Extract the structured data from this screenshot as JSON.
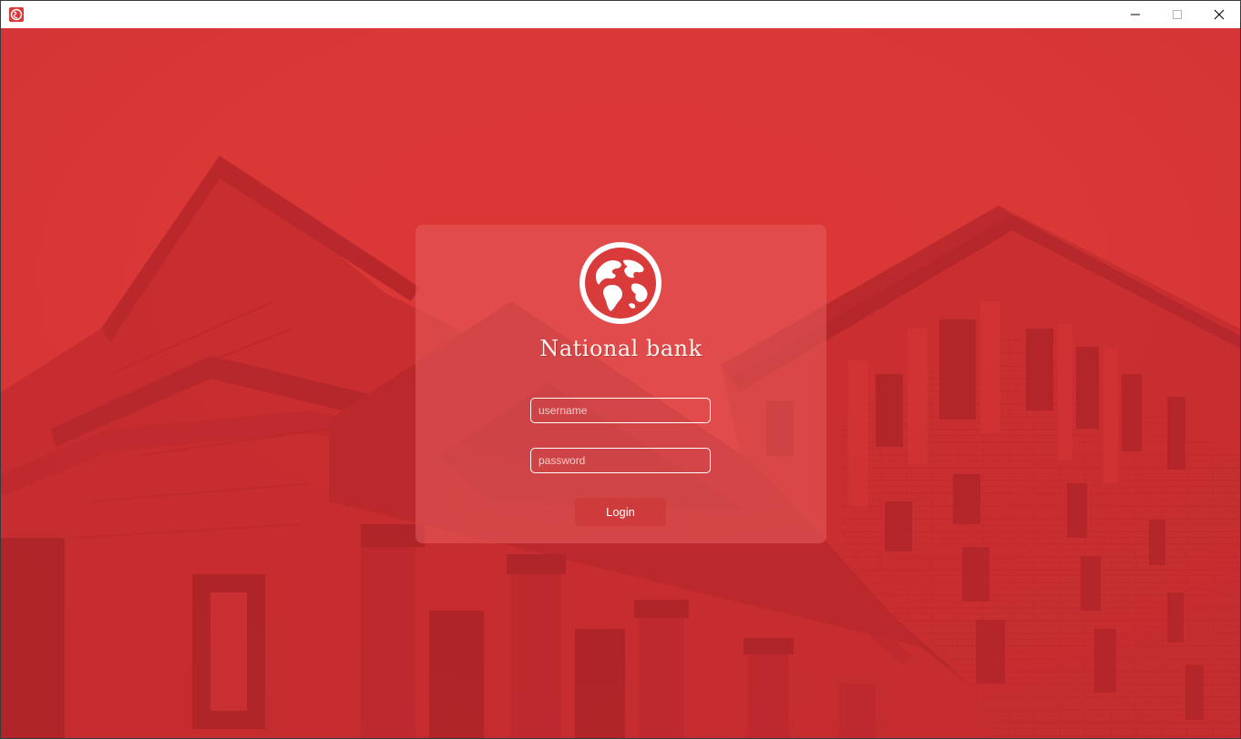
{
  "window": {
    "title": "",
    "controls": [
      "minimize",
      "maximize",
      "close"
    ]
  },
  "login": {
    "brand": "National bank",
    "username_placeholder": "username",
    "password_placeholder": "password",
    "login_label": "Login"
  },
  "icons": {
    "app": "globe-icon",
    "logo": "globe-icon",
    "minimize": "minimize-icon",
    "maximize": "maximize-icon",
    "close": "close-icon"
  },
  "colors": {
    "accent": "#dc3838",
    "accent_dark": "#a81e23",
    "card": "#e85c5c",
    "text": "#ffffff"
  }
}
